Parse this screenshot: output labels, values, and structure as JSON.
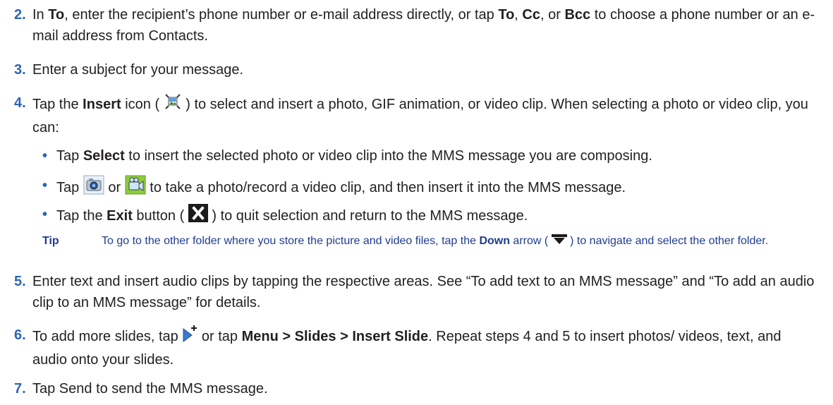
{
  "steps": [
    {
      "num": "2.",
      "p1": "In ",
      "b1": "To",
      "p2": ", enter the recipient’s phone number or e-mail address directly, or tap ",
      "b2": "To",
      "p3": ", ",
      "b3": "Cc",
      "p4": ", or ",
      "b4": "Bcc",
      "p5": " to choose a phone number or an e-mail address from Contacts."
    },
    {
      "num": "3.",
      "text": "Enter a subject for your message."
    },
    {
      "num": "4.",
      "p1": "Tap the ",
      "b1": "Insert",
      "p2": " icon ( ",
      "p3": " ) to select and insert a photo, GIF animation, or video clip. When selecting a photo or video clip, you can:"
    },
    {
      "num": "5.",
      "text": "Enter text and insert audio clips by tapping the respective areas. See “To add text to an MMS message” and “To add an audio clip to an MMS message” for details."
    },
    {
      "num": "6.",
      "p1": "To add more slides, tap ",
      "p2": " or tap ",
      "b1": "Menu > Slides > Insert Slide",
      "p3": ". Repeat steps 4 and 5 to insert photos/ videos, text, and audio onto your slides."
    },
    {
      "num": "7.",
      "text": "Tap Send to send the MMS message."
    }
  ],
  "bullets": [
    {
      "symbol": "•",
      "p1": "Tap ",
      "b1": "Select",
      "p2": " to insert the selected photo or video clip into the MMS message you are composing."
    },
    {
      "symbol": "•",
      "p1": "Tap ",
      "p2": " or ",
      "p3": " to take a photo/record a video clip, and then insert it into the MMS message."
    },
    {
      "symbol": "•",
      "p1": "Tap the ",
      "b1": "Exit",
      "p2": " button ( ",
      "p3": " ) to quit selection and return to the MMS message."
    }
  ],
  "tip": {
    "label": "Tip",
    "p1": "To go to the other folder where you store the picture and video files, tap the ",
    "b1": "Down",
    "p2": " arrow ( ",
    "p3": " ) to navigate and select the other folder."
  },
  "icons": {
    "insert": "insert-media-icon",
    "camera": "camera-icon",
    "video": "video-camera-icon",
    "exit": "exit-icon",
    "down": "down-arrow-icon",
    "add_slide": "add-slide-icon"
  },
  "colors": {
    "accent": "#2e64b4",
    "tip_text": "#1f3c8f",
    "body_text": "#231f20"
  }
}
